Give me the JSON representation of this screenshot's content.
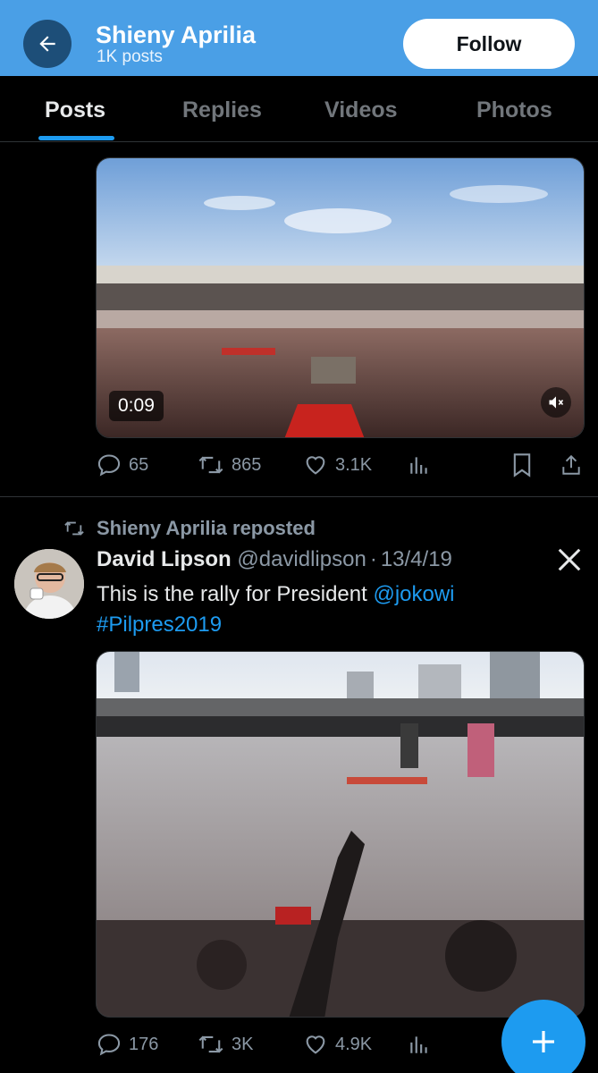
{
  "header": {
    "name": "Shieny Aprilia",
    "post_count": "1K posts",
    "follow_label": "Follow",
    "back_icon": "arrow-left-icon",
    "bg_color": "#4a9fe6"
  },
  "tabs": [
    {
      "label": "Posts",
      "active": true
    },
    {
      "label": "Replies",
      "active": false
    },
    {
      "label": "Videos",
      "active": false
    },
    {
      "label": "Photos",
      "active": false
    }
  ],
  "post1": {
    "media": {
      "type": "video",
      "duration": "0:09",
      "muted": true,
      "description_icon": "stadium-crowd-video"
    },
    "stats": {
      "replies": "65",
      "reposts": "865",
      "likes": "3.1K"
    }
  },
  "post2": {
    "repost_label": "Shieny Aprilia reposted",
    "author_name": "David Lipson",
    "author_handle": "@davidlipson",
    "separator": "·",
    "date": "13/4/19",
    "text_prefix": "This is the rally for President ",
    "mention": "@jokowi",
    "hashtag": "#Pilpres2019",
    "stats": {
      "replies": "176",
      "reposts": "3K",
      "likes": "4.9K"
    }
  },
  "colors": {
    "accent": "#1d9bf0",
    "muted_text": "#8b98a5",
    "background": "#000000"
  }
}
